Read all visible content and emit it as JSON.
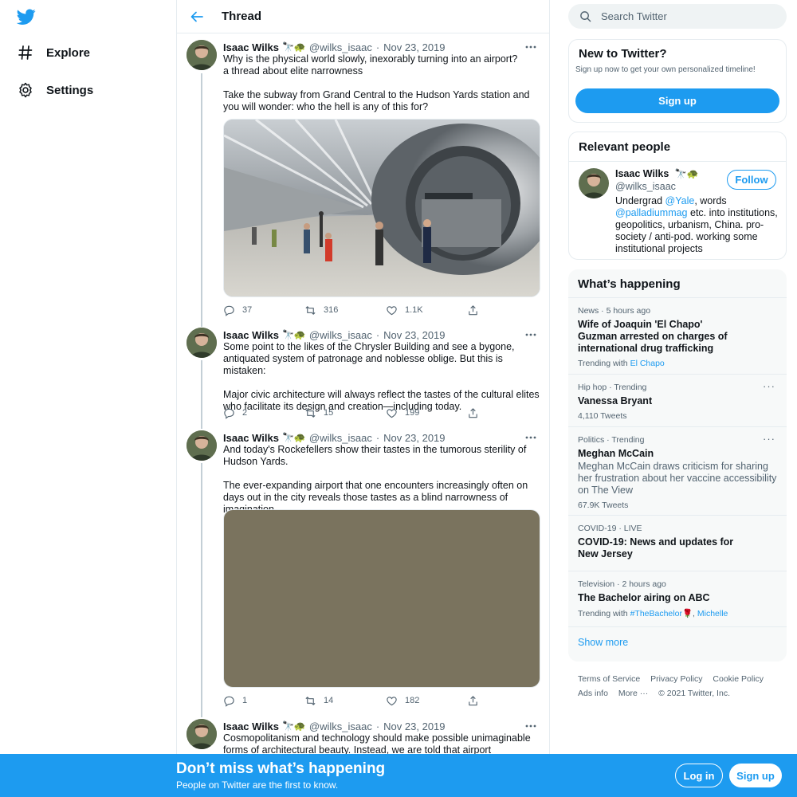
{
  "nav": {
    "items": [
      {
        "label": "Explore",
        "icon": "hashtag-icon"
      },
      {
        "label": "Settings",
        "icon": "gear-icon"
      }
    ]
  },
  "thread": {
    "title": "Thread",
    "tweets": [
      {
        "name": "Isaac Wilks",
        "emoji": "🔭🐢",
        "handle": "@wilks_isaac",
        "date": "Nov 23, 2019",
        "paragraphs": [
          "Why is the physical world slowly, inexorably turning into an airport?\na thread about elite narrowness",
          "Take the subway from Grand Central to the Hudson Yards station and you will wonder: who the hell is any of this for?"
        ],
        "replies": "37",
        "retweets": "316",
        "likes": "1.1K"
      },
      {
        "name": "Isaac Wilks",
        "emoji": "🔭🐢",
        "handle": "@wilks_isaac",
        "date": "Nov 23, 2019",
        "paragraphs": [
          "Some point to the likes of the Chrysler Building and see a bygone, antiquated system of patronage and noblesse oblige. But this is mistaken:",
          "Major civic architecture will always reflect the tastes of the cultural elites who facilitate its design and creation—including today."
        ],
        "replies": "2",
        "retweets": "15",
        "likes": "199"
      },
      {
        "name": "Isaac Wilks",
        "emoji": "🔭🐢",
        "handle": "@wilks_isaac",
        "date": "Nov 23, 2019",
        "paragraphs": [
          "And today's Rockefellers show their tastes in the tumorous sterility of Hudson Yards.",
          "The ever-expanding airport that one encounters increasingly often on days out in the city reveals those tastes as a blind narrowness of imagination."
        ],
        "replies": "1",
        "retweets": "14",
        "likes": "182"
      },
      {
        "name": "Isaac Wilks",
        "emoji": "🔭🐢",
        "handle": "@wilks_isaac",
        "date": "Nov 23, 2019",
        "paragraphs": [
          "Cosmopolitanism and technology should make possible unimaginable forms of architectural beauty. Instead, we are told that airport hegemony is what is"
        ]
      }
    ]
  },
  "search": {
    "placeholder": "Search Twitter"
  },
  "signup_card": {
    "title": "New to Twitter?",
    "subtitle": "Sign up now to get your own personalized timeline!",
    "button": "Sign up"
  },
  "relevant": {
    "title": "Relevant people",
    "name": "Isaac Wilks",
    "emoji": "🔭🐢",
    "handle": "@wilks_isaac",
    "follow": "Follow",
    "bio_prefix": "Undergrad ",
    "bio_link1": "@Yale",
    "bio_mid": ", words ",
    "bio_link2": "@palladiummag",
    "bio_rest": " etc. into institutions, geopolitics, urbanism, China. pro-society / anti-pod. working some institutional projects"
  },
  "happening": {
    "title": "What’s happening",
    "trends": [
      {
        "meta": "News · 5 hours ago",
        "title": "Wife of Joaquin 'El Chapo' Guzman arrested on charges of international drug trafficking",
        "sub_prefix": "Trending with ",
        "sub_link": "El Chapo"
      },
      {
        "meta": "Hip hop · Trending",
        "title": "Vanessa Bryant",
        "count": "4,110 Tweets"
      },
      {
        "meta": "Politics · Trending",
        "title": "Meghan McCain",
        "desc": "Meghan McCain draws criticism for sharing her frustration about her vaccine accessibility on The View",
        "count": "67.9K Tweets"
      },
      {
        "meta": "COVID-19 · LIVE",
        "title": "COVID-19: News and updates for New Jersey"
      },
      {
        "meta": "Television · 2 hours ago",
        "title": "The Bachelor airing on ABC",
        "sub_prefix": "Trending with ",
        "sub_link": "#TheBachelor",
        "sub_emoji": "🌹",
        "sub_link2": "Michelle"
      }
    ],
    "show_more": "Show more"
  },
  "footer": {
    "links": [
      "Terms of Service",
      "Privacy Policy",
      "Cookie Policy",
      "Ads info",
      "More ···",
      "© 2021 Twitter, Inc."
    ]
  },
  "bottom": {
    "title": "Don’t miss what’s happening",
    "subtitle": "People on Twitter are the first to know.",
    "login": "Log in",
    "signup": "Sign up"
  },
  "colors": {
    "accent": "#1d9bf0",
    "text": "#0f1419",
    "muted": "#536471",
    "border": "#e6ecf0",
    "media_placeholder": "#7a735e"
  }
}
